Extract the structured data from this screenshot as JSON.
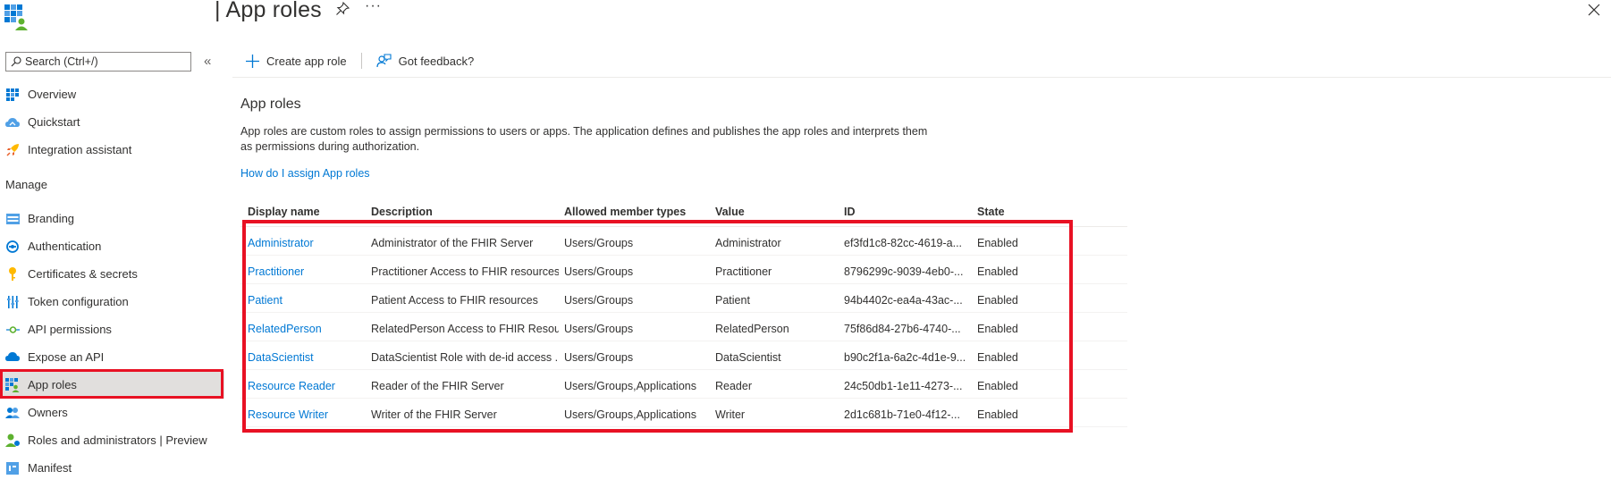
{
  "header": {
    "title": "| App roles",
    "more_label": "···"
  },
  "search": {
    "placeholder": "Search (Ctrl+/)"
  },
  "sidebar": {
    "collapse_label": "«",
    "items_top": [
      {
        "label": "Overview",
        "icon": "overview-icon"
      },
      {
        "label": "Quickstart",
        "icon": "quickstart-icon"
      },
      {
        "label": "Integration assistant",
        "icon": "rocket-icon"
      }
    ],
    "section_label": "Manage",
    "items_manage": [
      {
        "label": "Branding",
        "icon": "branding-icon"
      },
      {
        "label": "Authentication",
        "icon": "authentication-icon"
      },
      {
        "label": "Certificates & secrets",
        "icon": "key-icon"
      },
      {
        "label": "Token configuration",
        "icon": "token-icon"
      },
      {
        "label": "API permissions",
        "icon": "api-permissions-icon"
      },
      {
        "label": "Expose an API",
        "icon": "cloud-icon"
      },
      {
        "label": "App roles",
        "icon": "app-roles-icon",
        "selected": true
      },
      {
        "label": "Owners",
        "icon": "owners-icon"
      },
      {
        "label": "Roles and administrators | Preview",
        "icon": "roles-admin-icon"
      },
      {
        "label": "Manifest",
        "icon": "manifest-icon"
      }
    ]
  },
  "toolbar": {
    "create_label": "Create app role",
    "feedback_label": "Got feedback?"
  },
  "content": {
    "section_title": "App roles",
    "description_line1": "App roles are custom roles to assign permissions to users or apps. The application defines and publishes the app roles and interprets them",
    "description_line2": "as permissions during authorization.",
    "help_link": "How do I assign App roles"
  },
  "table": {
    "columns": [
      "Display name",
      "Description",
      "Allowed member types",
      "Value",
      "ID",
      "State"
    ],
    "rows": [
      {
        "name": "Administrator",
        "description": "Administrator of the FHIR Server",
        "member_types": "Users/Groups",
        "value": "Administrator",
        "id": "ef3fd1c8-82cc-4619-a...",
        "state": "Enabled"
      },
      {
        "name": "Practitioner",
        "description": "Practitioner Access to FHIR resources",
        "member_types": "Users/Groups",
        "value": "Practitioner",
        "id": "8796299c-9039-4eb0-...",
        "state": "Enabled"
      },
      {
        "name": "Patient",
        "description": "Patient Access to FHIR resources",
        "member_types": "Users/Groups",
        "value": "Patient",
        "id": "94b4402c-ea4a-43ac-...",
        "state": "Enabled"
      },
      {
        "name": "RelatedPerson",
        "description": "RelatedPerson Access to FHIR Resou...",
        "member_types": "Users/Groups",
        "value": "RelatedPerson",
        "id": "75f86d84-27b6-4740-...",
        "state": "Enabled"
      },
      {
        "name": "DataScientist",
        "description": "DataScientist Role with de-id access ...",
        "member_types": "Users/Groups",
        "value": "DataScientist",
        "id": "b90c2f1a-6a2c-4d1e-9...",
        "state": "Enabled"
      },
      {
        "name": "Resource Reader",
        "description": "Reader of the FHIR Server",
        "member_types": "Users/Groups,Applications",
        "value": "Reader",
        "id": "24c50db1-1e11-4273-...",
        "state": "Enabled"
      },
      {
        "name": "Resource Writer",
        "description": "Writer of the FHIR Server",
        "member_types": "Users/Groups,Applications",
        "value": "Writer",
        "id": "2d1c681b-71e0-4f12-...",
        "state": "Enabled"
      }
    ]
  },
  "colors": {
    "accent": "#0078d4",
    "highlight": "#e81123",
    "selected_bg": "#e1dfdd"
  }
}
